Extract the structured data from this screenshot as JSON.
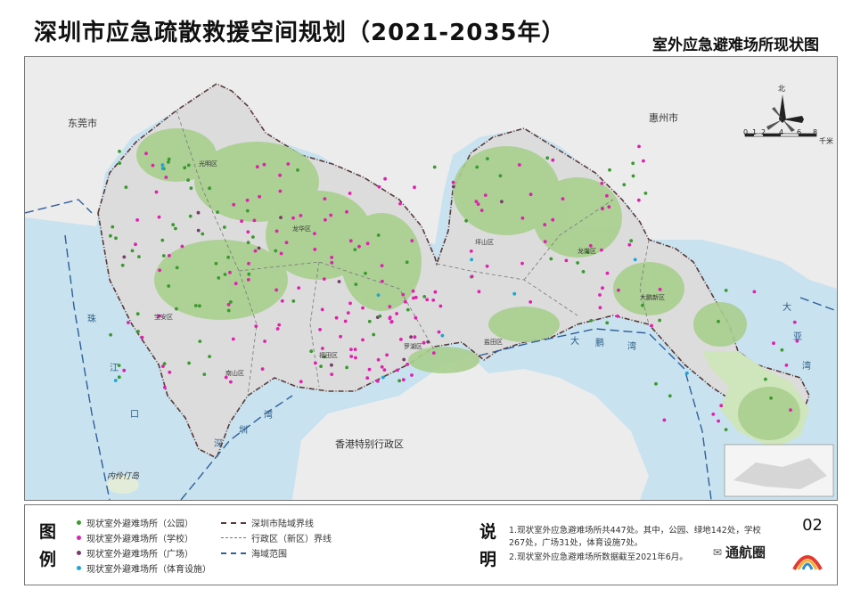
{
  "header": {
    "title": "深圳市应急疏散救援空间规划（2021-2035年）",
    "subtitle": "室外应急避难场所现状图"
  },
  "map": {
    "place_labels": {
      "dongguan": "东莞市",
      "huizhou": "惠州市",
      "hongkong": "香港特别行政区",
      "neilingding": "内伶仃岛"
    },
    "sea_labels": {
      "pearl_river": [
        "珠",
        "江",
        "口"
      ],
      "shenzhen_bay": [
        "深",
        "圳",
        "湾"
      ],
      "dapeng_bay": [
        "大",
        "鹏",
        "湾"
      ],
      "daya_bay": [
        "大",
        "亚",
        "湾"
      ]
    },
    "district_labels": [
      "光明区",
      "龙华区",
      "坪山区",
      "龙岗区",
      "宝安区",
      "南山区",
      "福田区",
      "罗湖区",
      "盐田区",
      "大鹏新区"
    ],
    "north_label": "北",
    "scale_ticks": [
      "0",
      "1",
      "2",
      "4",
      "6",
      "8"
    ],
    "scale_unit": "千米"
  },
  "legend": {
    "heading": [
      "图",
      "例"
    ],
    "items": [
      {
        "label": "现状室外避难场所（公园）",
        "color": "#3a9a2e"
      },
      {
        "label": "现状室外避难场所（学校）",
        "color": "#e020b0"
      },
      {
        "label": "现状室外避难场所（广场）",
        "color": "#7a3a6a"
      },
      {
        "label": "现状室外避难场所（体育设施）",
        "color": "#1aa6d4"
      }
    ],
    "lines": [
      {
        "label": "深圳市陆域界线"
      },
      {
        "label": "行政区（新区）界线"
      },
      {
        "label": "海域范围"
      }
    ]
  },
  "notes": {
    "heading": [
      "说",
      "明"
    ],
    "items": [
      "1.现状室外应急避难场所共447处。其中，公园、绿地142处，学校267处，广场31处，体育设施7处。",
      "2.现状室外应急避难场所数据截至2021年6月。"
    ]
  },
  "page_number": "02",
  "watermark": "通航圈",
  "colors": {
    "sea": "#c8e2ef",
    "land_outside": "#ececec",
    "shenzhen_base": "#dcdcdc",
    "green_space": "#a9cf8e",
    "park": "#3a9a2e",
    "school": "#e020b0",
    "square": "#7a3a6a",
    "sports": "#1aa6d4"
  }
}
